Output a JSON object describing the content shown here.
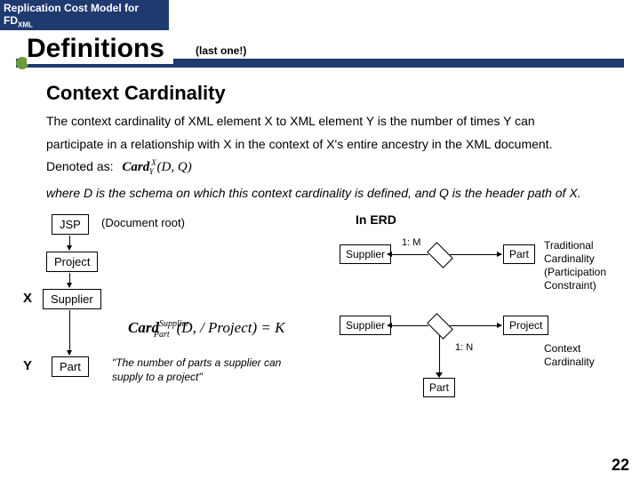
{
  "header": {
    "title_plain": "Replication Cost Model for FD",
    "title_sub": "XML"
  },
  "slide": {
    "title": "Definitions",
    "subtitle": "(last one!)"
  },
  "section": {
    "heading": "Context Cardinality",
    "body_a": "The context cardinality of XML element X to XML element Y is the number of times Y can participate in a relationship with X in the context of X's entire ancestry in the XML document. Denoted as:",
    "formula_inline": "Card (D, Q)",
    "formula_sup": "X",
    "formula_sub": "Y",
    "where": "where D is the schema on which this context cardinality is defined, and Q is the header path of X."
  },
  "tree": {
    "root": "JSP",
    "root_note": "(Document root)",
    "project": "Project",
    "supplier": "Supplier",
    "part": "Part",
    "x": "X",
    "y": "Y"
  },
  "formula_big": {
    "text": "Card",
    "sup": "Supplier",
    "sub": "Part",
    "args": "(D, / Project) = K"
  },
  "caption": "\"The number of parts a supplier can supply to a project\"",
  "erd": {
    "heading": "In ERD",
    "supplier": "Supplier",
    "part": "Part",
    "project": "Project",
    "one_m": "1: M",
    "one_n": "1: N",
    "trad": "Traditional Cardinality",
    "participation": "(Participation Constraint)",
    "context": "Context Cardinality"
  },
  "page": "22"
}
